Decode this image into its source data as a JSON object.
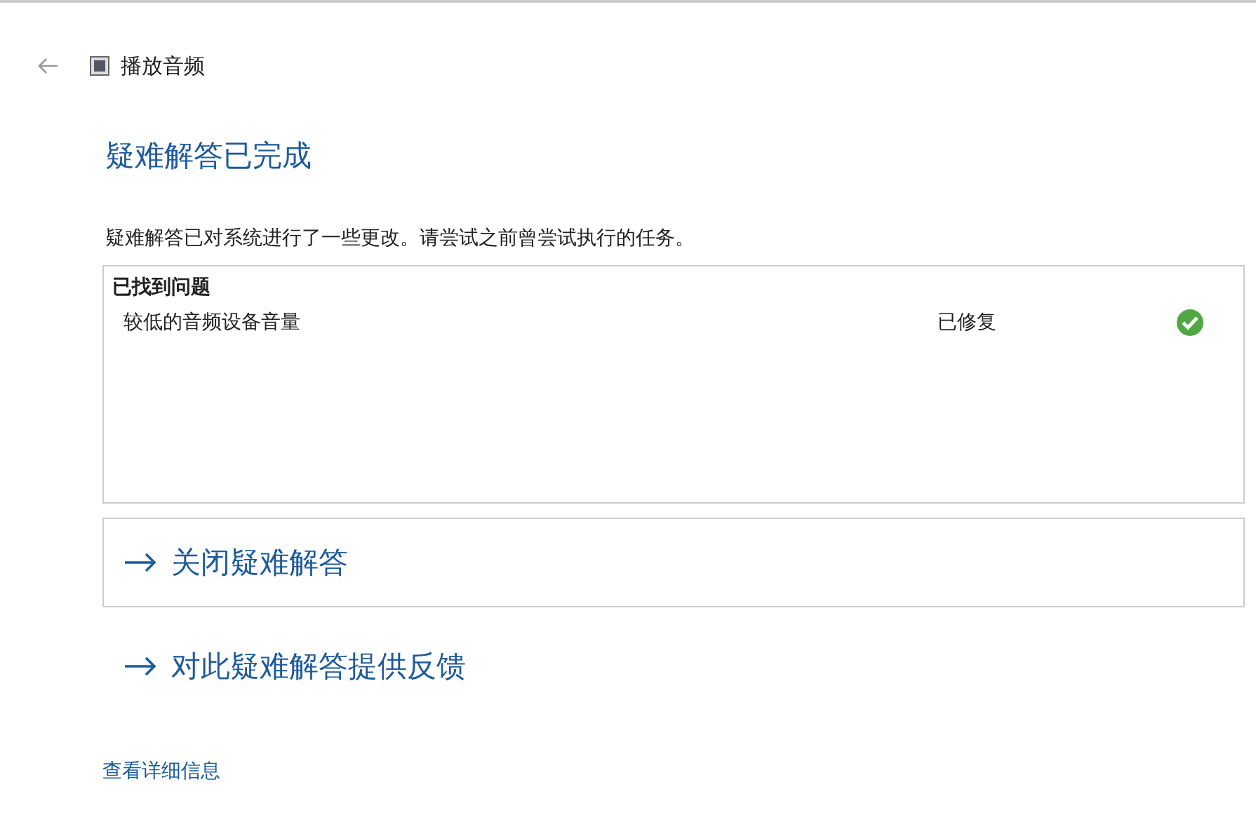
{
  "header": {
    "title": "播放音频"
  },
  "heading": "疑难解答已完成",
  "description": "疑难解答已对系统进行了一些更改。请尝试之前曾尝试执行的任务。",
  "problems": {
    "title": "已找到问题",
    "items": [
      {
        "name": "较低的音频设备音量",
        "status": "已修复",
        "fixed": true
      }
    ]
  },
  "actions": [
    {
      "label": "关闭疑难解答",
      "boxed": true
    },
    {
      "label": "对此疑难解答提供反馈",
      "boxed": false
    }
  ],
  "details_link": "查看详细信息"
}
